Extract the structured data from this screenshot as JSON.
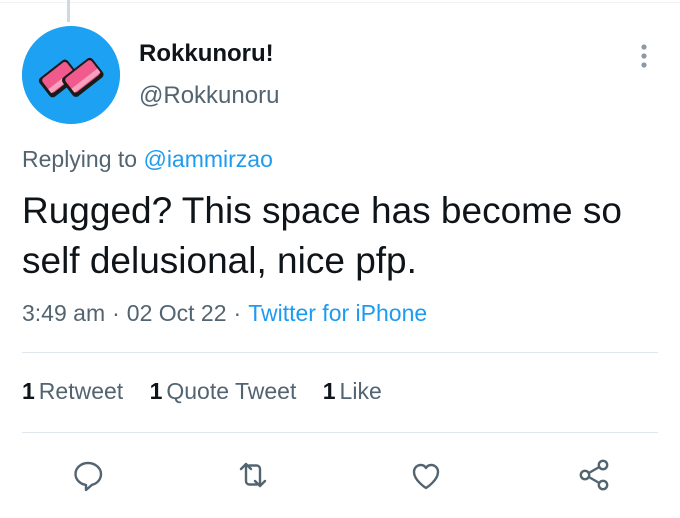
{
  "tweet": {
    "author": {
      "display_name": "Rokkunoru!",
      "handle": "@Rokkunoru",
      "avatar_icon": "pink-eraser-avatar"
    },
    "replying_prefix": "Replying to",
    "replying_to": "@iammirzao",
    "text": "Rugged? This space has become so self delusional, nice pfp.",
    "time": "3:49 am",
    "date": "02 Oct 22",
    "separator": "·",
    "source": "Twitter for iPhone",
    "stats": {
      "retweets_count": "1",
      "retweets_label": "Retweet",
      "quotes_count": "1",
      "quotes_label": "Quote Tweet",
      "likes_count": "1",
      "likes_label": "Like"
    },
    "actions": [
      "reply-icon",
      "retweet-icon",
      "like-icon",
      "share-icon"
    ]
  },
  "colors": {
    "accent": "#1d9bf0",
    "muted_text": "#536471",
    "avatar_bg": "#1da1f2",
    "avatar_eraser": "#f05a8c"
  }
}
